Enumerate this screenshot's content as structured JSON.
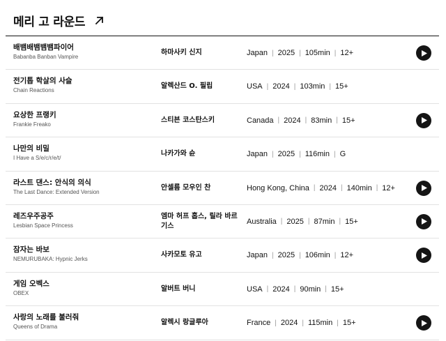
{
  "section": {
    "title": "메리 고 라운드",
    "link_icon": "arrow-up-right-icon"
  },
  "films": [
    {
      "title_ko": "배뱀배뱀뱀뱀파이어",
      "title_en": "Babanba Banban Vampire",
      "director": "하마사키 신지",
      "country": "Japan",
      "year": "2025",
      "runtime": "105min",
      "rating": "12+",
      "has_trailer": true
    },
    {
      "title_ko": "전기톱 학살의 사슬",
      "title_en": "Chain Reactions",
      "director": "알렉산드 O. 필립",
      "country": "USA",
      "year": "2024",
      "runtime": "103min",
      "rating": "15+",
      "has_trailer": false
    },
    {
      "title_ko": "요상한 프랭키",
      "title_en": "Frankie Freako",
      "director": "스티븐 코스탄스키",
      "country": "Canada",
      "year": "2024",
      "runtime": "83min",
      "rating": "15+",
      "has_trailer": true
    },
    {
      "title_ko": "나만의 비밀",
      "title_en": "I Have a S/e/c/r/e/t/",
      "director": "나카가와 슌",
      "country": "Japan",
      "year": "2025",
      "runtime": "116min",
      "rating": "G",
      "has_trailer": false
    },
    {
      "title_ko": "라스트 댄스: 안식의 의식",
      "title_en": "The Last Dance: Extended Version",
      "director": "안셀름 모우인 찬",
      "country": "Hong Kong, China",
      "year": "2024",
      "runtime": "140min",
      "rating": "12+",
      "has_trailer": true
    },
    {
      "title_ko": "레즈우주공주",
      "title_en": "Lesbian Space Princess",
      "director": "엠마 허프 홉스, 릴라 바르기스",
      "country": "Australia",
      "year": "2025",
      "runtime": "87min",
      "rating": "15+",
      "has_trailer": true
    },
    {
      "title_ko": "잠자는 바보",
      "title_en": "NEMURUBAKA: Hypnic Jerks",
      "director": "사카모토 유고",
      "country": "Japan",
      "year": "2025",
      "runtime": "106min",
      "rating": "12+",
      "has_trailer": true
    },
    {
      "title_ko": "게임 오벡스",
      "title_en": "OBEX",
      "director": "알버트 버니",
      "country": "USA",
      "year": "2024",
      "runtime": "90min",
      "rating": "15+",
      "has_trailer": false
    },
    {
      "title_ko": "사랑의 노래를 불러줘",
      "title_en": "Queens of Drama",
      "director": "알렉시 랑글루아",
      "country": "France",
      "year": "2024",
      "runtime": "115min",
      "rating": "15+",
      "has_trailer": true
    }
  ],
  "icons": {
    "play": "play-icon"
  }
}
